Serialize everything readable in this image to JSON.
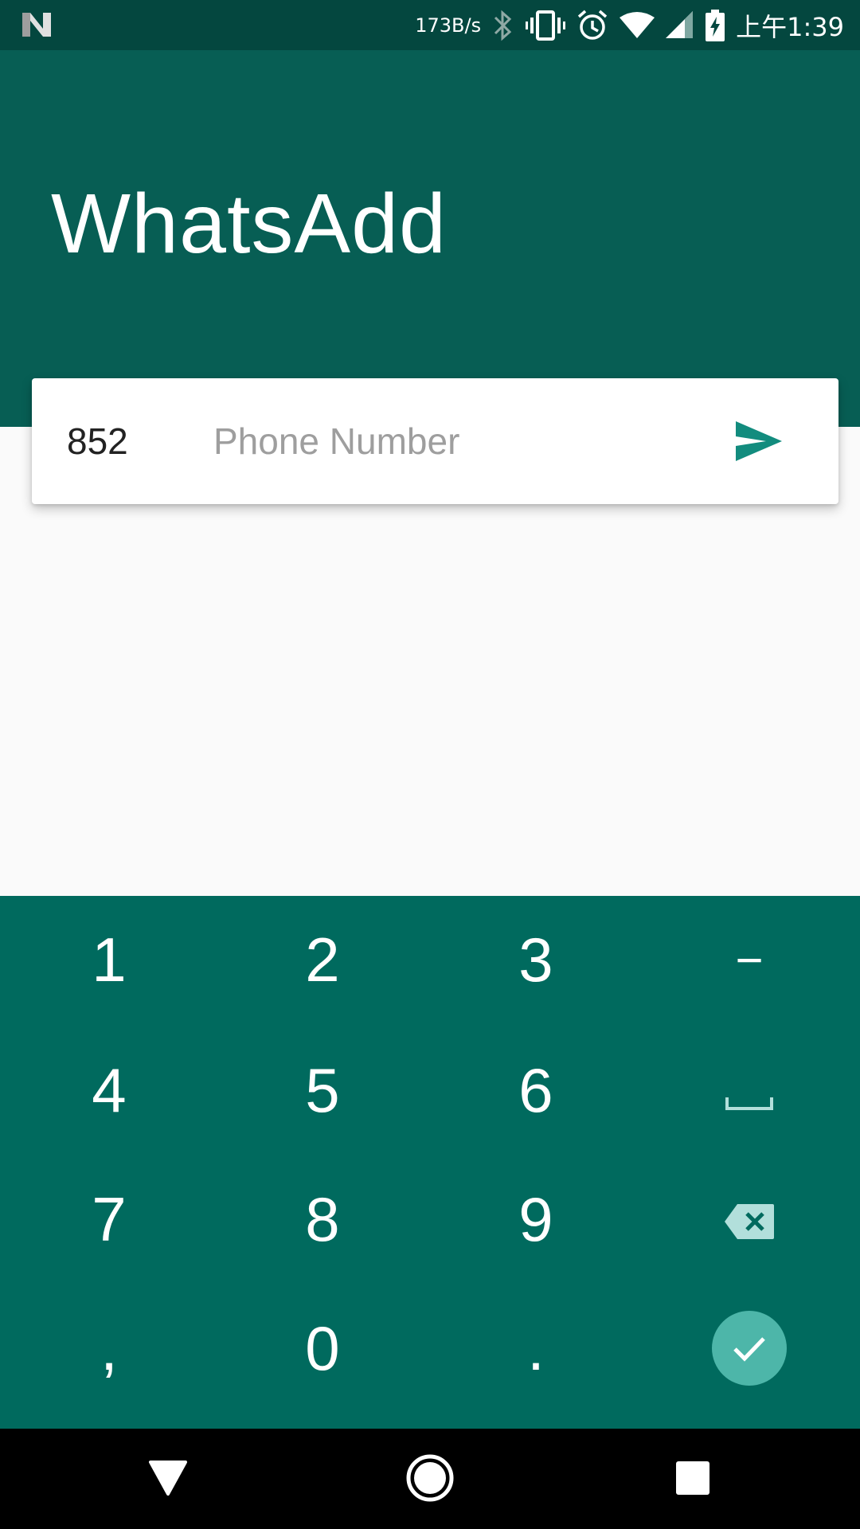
{
  "status_bar": {
    "net_speed": "173B/s",
    "time": "上午1:39",
    "icons": [
      "notification-n-icon",
      "bluetooth-icon",
      "vibrate-icon",
      "alarm-icon",
      "wifi-icon",
      "cell-signal-icon",
      "battery-charging-icon"
    ]
  },
  "app": {
    "title": "WhatsAdd"
  },
  "input_card": {
    "country_code": "852",
    "phone_value": "",
    "phone_placeholder": "Phone Number",
    "send_icon": "send-icon"
  },
  "keypad": {
    "keys": [
      [
        "1",
        "2",
        "3",
        "−"
      ],
      [
        "4",
        "5",
        "6",
        "space-icon"
      ],
      [
        "7",
        "8",
        "9",
        "backspace-icon"
      ],
      [
        ",",
        "0",
        ".",
        "done-icon"
      ]
    ]
  },
  "nav_bar": {
    "icons": [
      "back-icon",
      "home-icon",
      "recents-icon"
    ]
  },
  "colors": {
    "status_bar": "#04473f",
    "app_bar": "#075e54",
    "keypad": "#006a5e",
    "accent": "#128c7e",
    "done_button": "#4db6a9"
  }
}
